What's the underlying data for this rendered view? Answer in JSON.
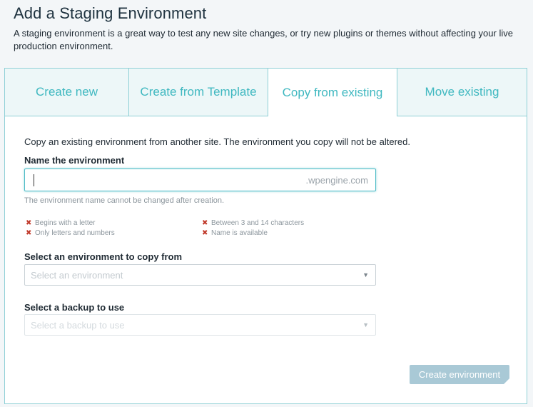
{
  "header": {
    "title": "Add a Staging Environment",
    "subtitle": "A staging environment is a great way to test any new site changes, or try new plugins or themes without affecting your live production environment."
  },
  "tabs": [
    {
      "label": "Create new",
      "active": false
    },
    {
      "label": "Create from Template",
      "active": false
    },
    {
      "label": "Copy from existing",
      "active": true
    },
    {
      "label": "Move existing",
      "active": false
    }
  ],
  "form": {
    "description": "Copy an existing environment from another site. The environment you copy will not be altered.",
    "name_label": "Name the environment",
    "name_value": "",
    "name_suffix": ".wpengine.com",
    "name_hint": "The environment name cannot be changed after creation.",
    "requirements": [
      {
        "text": "Begins with a letter",
        "met": false
      },
      {
        "text": "Only letters and numbers",
        "met": false
      },
      {
        "text": "Between 3 and 14 characters",
        "met": false
      },
      {
        "text": "Name is available",
        "met": false
      }
    ],
    "requirement_mark": "✖",
    "env_label": "Select an environment to copy from",
    "env_placeholder": "Select an environment",
    "backup_label": "Select a backup to use",
    "backup_placeholder": "Select a backup to use",
    "submit_label": "Create environment"
  },
  "colors": {
    "accent": "#3fb8c0",
    "border": "#8fd0d6",
    "error": "#c0392b",
    "button_disabled": "#a9c9d6"
  },
  "icons": {
    "requirement": "x-mark-icon",
    "dropdown": "triangle-down-icon"
  }
}
